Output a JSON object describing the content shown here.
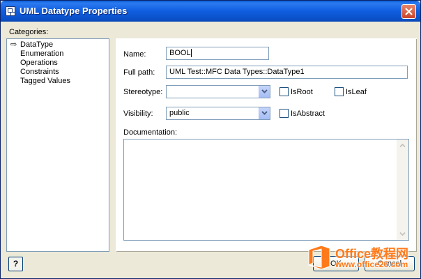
{
  "window": {
    "title": "UML Datatype Properties"
  },
  "categories": {
    "label": "Categories:",
    "items": [
      {
        "label": "DataType",
        "selected": true
      },
      {
        "label": "Enumeration"
      },
      {
        "label": "Operations"
      },
      {
        "label": "Constraints"
      },
      {
        "label": "Tagged Values"
      }
    ]
  },
  "form": {
    "name_label": "Name:",
    "name_value": "BOOL",
    "fullpath_label": "Full path:",
    "fullpath_value": "UML Test::MFC Data Types::DataType1",
    "stereotype_label": "Stereotype:",
    "stereotype_value": "",
    "visibility_label": "Visibility:",
    "visibility_value": "public",
    "isroot_label": "IsRoot",
    "isleaf_label": "IsLeaf",
    "isabstract_label": "IsAbstract",
    "documentation_label": "Documentation:",
    "documentation_value": ""
  },
  "buttons": {
    "help_label": "?",
    "ok_label": "OK",
    "cancel_label": "Cancel"
  },
  "watermark": {
    "name": "Office教程网",
    "url": "www.office26.com"
  },
  "colors": {
    "titlebar": "#0a5fd8",
    "dialog_bg": "#ece9d8",
    "field_border": "#7f9db9",
    "watermark": "#ff7a1a"
  }
}
